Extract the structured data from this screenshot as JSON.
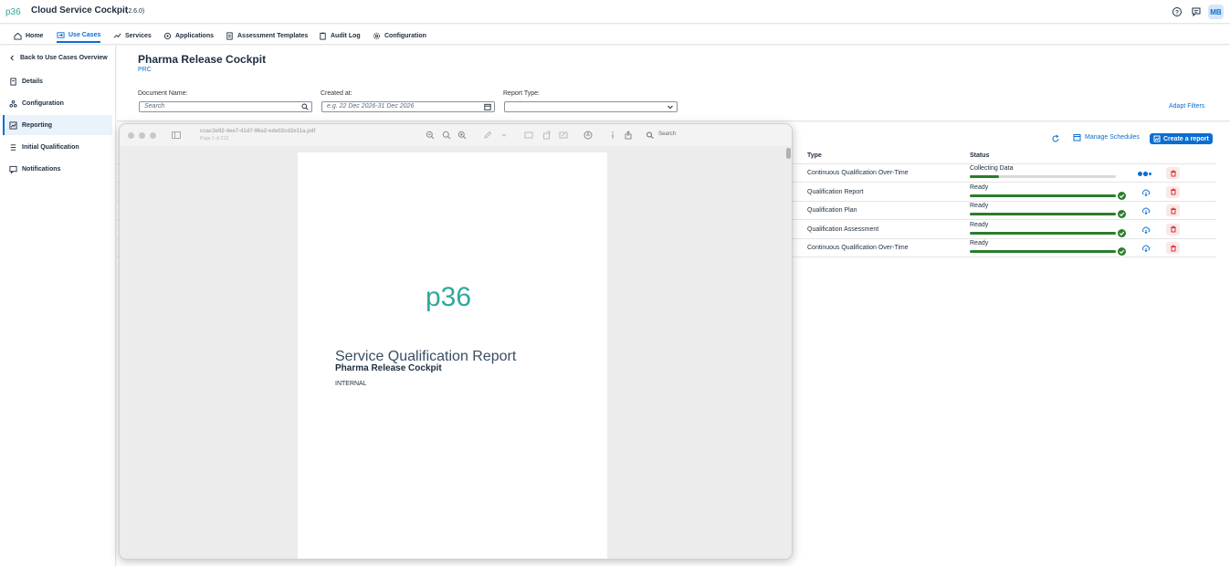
{
  "shell": {
    "logo_text": "p36",
    "title": "Cloud Service Cockpit",
    "version": "(2.6.0)",
    "avatar": "MB",
    "colors": {
      "brand": "#2fa89a",
      "accent": "#0a6ed1"
    }
  },
  "nav": {
    "tabs": [
      {
        "label": "Home",
        "icon": "home-icon"
      },
      {
        "label": "Use Cases",
        "icon": "use-cases-icon",
        "active": true
      },
      {
        "label": "Services",
        "icon": "services-icon"
      },
      {
        "label": "Applications",
        "icon": "applications-icon"
      },
      {
        "label": "Assessment Templates",
        "icon": "assessment-templates-icon"
      },
      {
        "label": "Audit Log",
        "icon": "audit-log-icon"
      },
      {
        "label": "Configuration",
        "icon": "configuration-icon"
      }
    ]
  },
  "sidebar": {
    "back_label": "Back to Use Cases Overview",
    "items": [
      {
        "label": "Details",
        "icon": "details-icon"
      },
      {
        "label": "Configuration",
        "icon": "configuration-icon"
      },
      {
        "label": "Reporting",
        "icon": "reporting-icon",
        "active": true
      },
      {
        "label": "Initial Qualification",
        "icon": "initial-qualification-icon"
      },
      {
        "label": "Notifications",
        "icon": "notifications-icon"
      }
    ]
  },
  "header": {
    "title": "Pharma Release Cockpit",
    "subtitle": "PRC",
    "filters": {
      "document_name_label": "Document Name:",
      "document_name_placeholder": "Search",
      "created_at_label": "Created at:",
      "created_at_placeholder": "e.g. 22 Dec 2026-31 Dec 2026",
      "report_type_label": "Report Type:",
      "report_type_value": ""
    },
    "adapt_filters": "Adapt Filters"
  },
  "table": {
    "manage_schedules": "Manage Schedules",
    "create_report": "Create a report",
    "columns": {
      "type": "Type",
      "status": "Status"
    },
    "rows": [
      {
        "type": "Continuous Qualification Over-Time",
        "status": "Collecting Data",
        "progress": 0.2,
        "state": "collecting"
      },
      {
        "type": "Qualification Report",
        "status": "Ready",
        "progress": 1.0,
        "state": "ready"
      },
      {
        "type": "Qualification Plan",
        "status": "Ready",
        "progress": 1.0,
        "state": "ready"
      },
      {
        "type": "Qualification Assessment",
        "status": "Ready",
        "progress": 1.0,
        "state": "ready"
      },
      {
        "type": "Continuous Qualification Over-Time",
        "status": "Ready",
        "progress": 1.0,
        "state": "ready"
      }
    ]
  },
  "pdf_viewer": {
    "filename": "ccac3e92-4ee7-41d7-96a2-ede02cd2e11a.pdf",
    "page_info": "Page 1 of 212",
    "search_label": "Search",
    "page": {
      "logo_text": "p36",
      "title": "Service Qualification Report",
      "subtitle": "Pharma Release Cockpit",
      "classification": "INTERNAL"
    }
  }
}
